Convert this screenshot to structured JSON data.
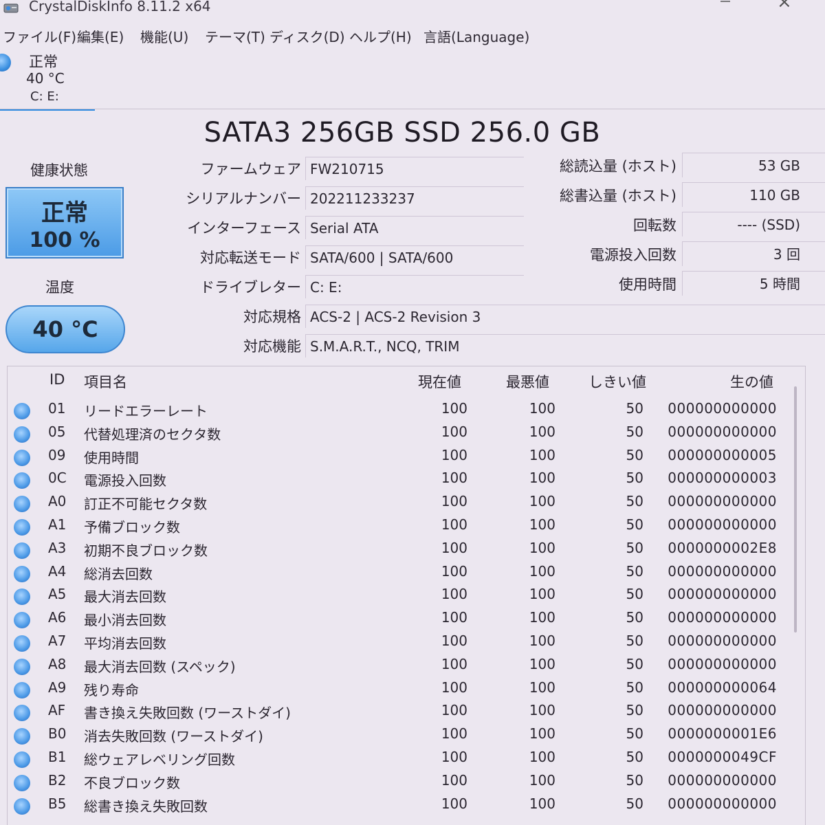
{
  "window": {
    "title": "CrystalDiskInfo 8.11.2 x64",
    "close_glyph": "×"
  },
  "menu": [
    "ファイル(F)",
    "編集(E)",
    "機能(U)",
    "テーマ(T)",
    "ディスク(D)",
    "ヘルプ(H)",
    "言語(Language)"
  ],
  "disk_tab": {
    "status": "正常",
    "temp": "40 °C",
    "drives": "C: E:"
  },
  "model": "SATA3 256GB SSD 256.0 GB",
  "health": {
    "label": "健康状態",
    "status": "正常",
    "percent": "100 %"
  },
  "temperature": {
    "label": "温度",
    "value": "40 °C"
  },
  "info": [
    {
      "label": "ファームウェア",
      "value": "FW210715"
    },
    {
      "label": "シリアルナンバー",
      "value": "202211233237"
    },
    {
      "label": "インターフェース",
      "value": "Serial ATA"
    },
    {
      "label": "対応転送モード",
      "value": "SATA/600 | SATA/600"
    },
    {
      "label": "ドライブレター",
      "value": "C: E:"
    },
    {
      "label": "対応規格",
      "value": "ACS-2 | ACS-2 Revision 3"
    },
    {
      "label": "対応機能",
      "value": "S.M.A.R.T., NCQ, TRIM"
    }
  ],
  "right_info": [
    {
      "label": "総読込量 (ホスト)",
      "value": "53 GB"
    },
    {
      "label": "総書込量 (ホスト)",
      "value": "110 GB"
    },
    {
      "label": "回転数",
      "value": "---- (SSD)"
    },
    {
      "label": "電源投入回数",
      "value": "3 回"
    },
    {
      "label": "使用時間",
      "value": "5 時間"
    }
  ],
  "smart": {
    "headers": {
      "id": "ID",
      "name": "項目名",
      "current": "現在値",
      "worst": "最悪値",
      "threshold": "しきい値",
      "raw": "生の値"
    },
    "rows": [
      {
        "id": "01",
        "name": "リードエラーレート",
        "current": "100",
        "worst": "100",
        "threshold": "50",
        "raw": "000000000000"
      },
      {
        "id": "05",
        "name": "代替処理済のセクタ数",
        "current": "100",
        "worst": "100",
        "threshold": "50",
        "raw": "000000000000"
      },
      {
        "id": "09",
        "name": "使用時間",
        "current": "100",
        "worst": "100",
        "threshold": "50",
        "raw": "000000000005"
      },
      {
        "id": "0C",
        "name": "電源投入回数",
        "current": "100",
        "worst": "100",
        "threshold": "50",
        "raw": "000000000003"
      },
      {
        "id": "A0",
        "name": "訂正不可能セクタ数",
        "current": "100",
        "worst": "100",
        "threshold": "50",
        "raw": "000000000000"
      },
      {
        "id": "A1",
        "name": "予備ブロック数",
        "current": "100",
        "worst": "100",
        "threshold": "50",
        "raw": "000000000000"
      },
      {
        "id": "A3",
        "name": "初期不良ブロック数",
        "current": "100",
        "worst": "100",
        "threshold": "50",
        "raw": "0000000002E8"
      },
      {
        "id": "A4",
        "name": "総消去回数",
        "current": "100",
        "worst": "100",
        "threshold": "50",
        "raw": "000000000000"
      },
      {
        "id": "A5",
        "name": "最大消去回数",
        "current": "100",
        "worst": "100",
        "threshold": "50",
        "raw": "000000000000"
      },
      {
        "id": "A6",
        "name": "最小消去回数",
        "current": "100",
        "worst": "100",
        "threshold": "50",
        "raw": "000000000000"
      },
      {
        "id": "A7",
        "name": "平均消去回数",
        "current": "100",
        "worst": "100",
        "threshold": "50",
        "raw": "000000000000"
      },
      {
        "id": "A8",
        "name": "最大消去回数 (スペック)",
        "current": "100",
        "worst": "100",
        "threshold": "50",
        "raw": "000000000000"
      },
      {
        "id": "A9",
        "name": "残り寿命",
        "current": "100",
        "worst": "100",
        "threshold": "50",
        "raw": "000000000064"
      },
      {
        "id": "AF",
        "name": "書き換え失敗回数 (ワーストダイ)",
        "current": "100",
        "worst": "100",
        "threshold": "50",
        "raw": "000000000000"
      },
      {
        "id": "B0",
        "name": "消去失敗回数 (ワーストダイ)",
        "current": "100",
        "worst": "100",
        "threshold": "50",
        "raw": "0000000001E6"
      },
      {
        "id": "B1",
        "name": "総ウェアレベリング回数",
        "current": "100",
        "worst": "100",
        "threshold": "50",
        "raw": "0000000049CF"
      },
      {
        "id": "B2",
        "name": "不良ブロック数",
        "current": "100",
        "worst": "100",
        "threshold": "50",
        "raw": "000000000000"
      },
      {
        "id": "B5",
        "name": "総書き換え失敗回数",
        "current": "100",
        "worst": "100",
        "threshold": "50",
        "raw": "000000000000"
      }
    ]
  }
}
